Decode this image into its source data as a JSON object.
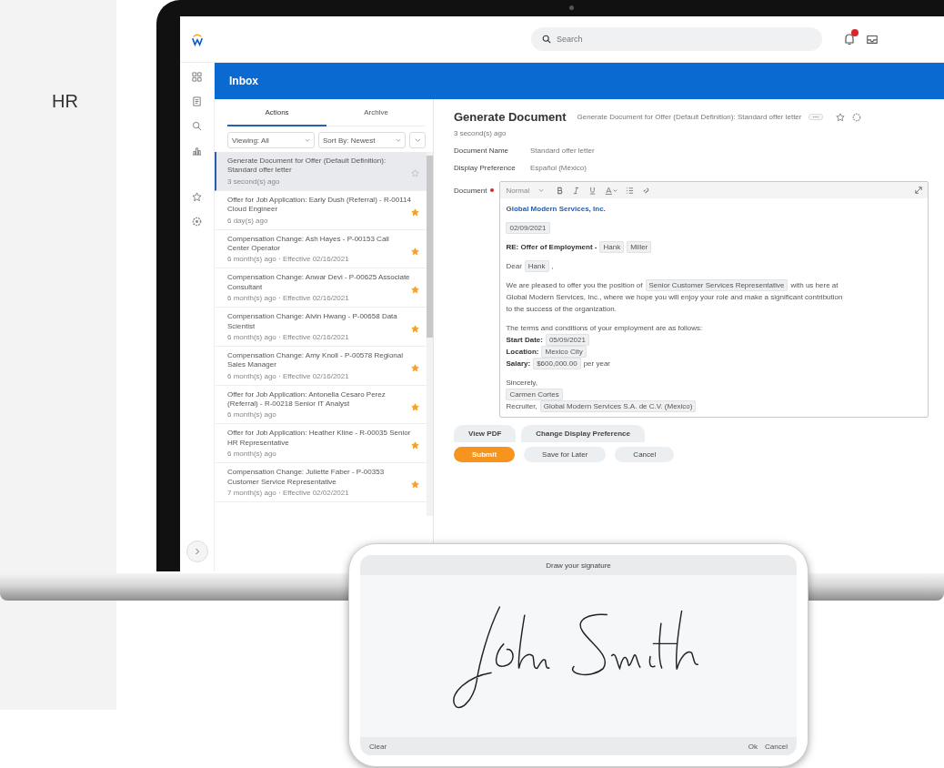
{
  "page": {
    "heading": "HR"
  },
  "app": {
    "search": {
      "placeholder": "Search"
    },
    "notifications": {
      "unread": true
    }
  },
  "inbox": {
    "title": "Inbox",
    "tabs": [
      {
        "label": "Actions",
        "selected": true
      },
      {
        "label": "Archive",
        "selected": false
      }
    ],
    "filters": [
      {
        "label": "Viewing: All"
      },
      {
        "label": "Sort By: Newest"
      }
    ],
    "items": [
      {
        "title": "Generate Document for Offer (Default Definition): Standard offer letter",
        "meta": "3 second(s) ago",
        "selected": true,
        "starred": false
      },
      {
        "title": "Offer for Job Application: Early Dush (Referral) - R-00114 Cloud Engineer",
        "meta": "6 day(s) ago",
        "selected": false,
        "starred": true
      },
      {
        "title": "Compensation Change: Ash Hayes - P-00153 Call Center Operator",
        "meta": "6 month(s) ago · Effective 02/16/2021",
        "selected": false,
        "starred": true
      },
      {
        "title": "Compensation Change: Anwar Devi - P-00625 Associate Consultant",
        "meta": "6 month(s) ago · Effective 02/16/2021",
        "selected": false,
        "starred": true
      },
      {
        "title": "Compensation Change: Alvin Hwang - P-00658 Data Scientist",
        "meta": "6 month(s) ago · Effective 02/16/2021",
        "selected": false,
        "starred": true
      },
      {
        "title": "Compensation Change: Amy Knoll - P-00578 Regional Sales Manager",
        "meta": "6 month(s) ago · Effective 02/16/2021",
        "selected": false,
        "starred": true
      },
      {
        "title": "Offer for Job Application: Antonella Cesaro Perez (Referral) - R-00218 Senior IT Analyst",
        "meta": "6 month(s) ago",
        "selected": false,
        "starred": true
      },
      {
        "title": "Offer for Job Application: Heather Kline - R-00035 Senior HR Representative",
        "meta": "6 month(s) ago",
        "selected": false,
        "starred": true
      },
      {
        "title": "Compensation Change: Juliette Faber - P-00353 Customer Service Representative",
        "meta": "7 month(s) ago · Effective 02/02/2021",
        "selected": false,
        "starred": true
      }
    ]
  },
  "detail": {
    "title": "Generate Document",
    "subtitle": "Generate Document for Offer (Default Definition): Standard offer letter",
    "time": "3 second(s) ago",
    "fields": [
      {
        "label": "Document Name",
        "value": "Standard offer letter"
      },
      {
        "label": "Display Preference",
        "value": "Español (México)"
      }
    ],
    "document": {
      "label": "Document",
      "required": true,
      "style": "Normal",
      "paragraphs": [
        [
          [
            {
              "kind": "heading",
              "text": "Global Modern Services, Inc."
            }
          ]
        ],
        [
          [
            {
              "kind": "field",
              "text": "02/09/2021"
            }
          ]
        ],
        [
          [
            {
              "kind": "bold",
              "text": "RE: Offer of Employment -"
            },
            {
              "kind": "field",
              "text": "Hank"
            },
            {
              "kind": "field",
              "text": "Miller"
            }
          ]
        ],
        [
          [
            {
              "kind": "text",
              "text": "Dear"
            },
            {
              "kind": "field",
              "text": "Hank"
            },
            {
              "kind": "text",
              "text": ","
            }
          ]
        ],
        [
          [
            {
              "kind": "text",
              "text": "We are pleased to offer you the position of"
            },
            {
              "kind": "field",
              "text": "Senior Customer Services Representative"
            },
            {
              "kind": "text",
              "text": "with us here at"
            }
          ],
          [
            {
              "kind": "text",
              "text": "Global Modern Services, Inc., where we hope you will enjoy your role and make a significant contribution"
            }
          ],
          [
            {
              "kind": "text",
              "text": "to the success of the organization."
            }
          ]
        ],
        [
          [
            {
              "kind": "text",
              "text": "The terms and conditions of your employment are as follows:"
            }
          ],
          [
            {
              "kind": "bold",
              "text": "Start Date:"
            },
            {
              "kind": "field",
              "text": "05/09/2021"
            }
          ],
          [
            {
              "kind": "bold",
              "text": "Location:"
            },
            {
              "kind": "field",
              "text": "Mexico City"
            }
          ],
          [
            {
              "kind": "bold",
              "text": "Salary:"
            },
            {
              "kind": "field",
              "text": "$600,000.00"
            },
            {
              "kind": "text",
              "text": "per year"
            }
          ]
        ],
        [
          [
            {
              "kind": "text",
              "text": "Sincerely,"
            }
          ],
          [
            {
              "kind": "field",
              "text": "Carmen Cortes"
            }
          ],
          [
            {
              "kind": "text",
              "text": "Recruiter,"
            },
            {
              "kind": "field",
              "text": "Global Modern Services S.A. de C.V. (Mexico)"
            }
          ]
        ]
      ]
    },
    "secondary_buttons": [
      {
        "label": "View PDF"
      },
      {
        "label": "Change Display Preference"
      }
    ],
    "actions": [
      {
        "label": "Submit",
        "kind": "primary"
      },
      {
        "label": "Save for Later",
        "kind": "secondary"
      },
      {
        "label": "Cancel",
        "kind": "secondary"
      }
    ]
  },
  "signature_pad": {
    "title": "Draw your signature",
    "left_buttons": [
      {
        "label": "Clear"
      }
    ],
    "right_buttons": [
      {
        "label": "Ok"
      },
      {
        "label": "Cancel"
      }
    ]
  }
}
